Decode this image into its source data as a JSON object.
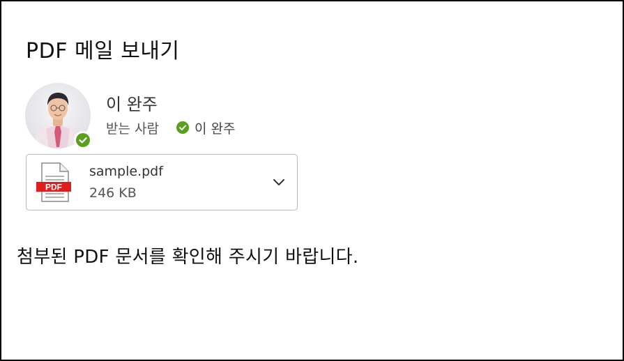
{
  "title": "PDF 메일 보내기",
  "sender": {
    "name": "이 완주",
    "avatar_icon": "person-photo-avatar",
    "presence": "available",
    "presence_color": "#5aa01a"
  },
  "recipient": {
    "label": "받는 사람",
    "name": "이 완주",
    "status_icon": "check-circle-icon",
    "status_color": "#5aa01a"
  },
  "attachment": {
    "file_name": "sample.pdf",
    "file_size": "246 KB",
    "file_type_label": "PDF",
    "file_icon": "pdf-file-icon",
    "expand_icon": "chevron-down-icon",
    "badge_color": "#e11d1d"
  },
  "message": {
    "body": "첨부된 PDF 문서를 확인해 주시기 바랍니다."
  }
}
